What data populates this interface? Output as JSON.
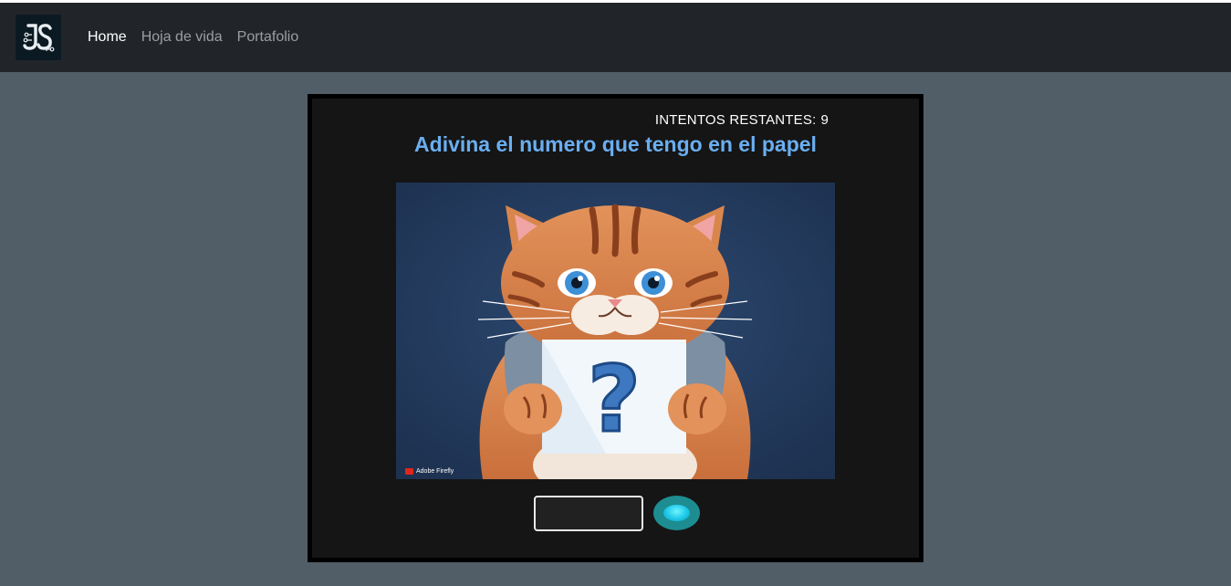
{
  "navbar": {
    "brand_icon": "js-logo-icon",
    "links": [
      {
        "label": "Home",
        "active": true
      },
      {
        "label": "Hoja de vida",
        "active": false
      },
      {
        "label": "Portafolio",
        "active": false
      }
    ]
  },
  "game": {
    "attempts_label": "INTENTOS RESTANTES:",
    "attempts_value": "9",
    "title": "Adivina el numero que tengo en el papel",
    "image_icon": "cat-holding-question-mark-sign",
    "watermark": "Adobe Firefly",
    "input": {
      "value": "",
      "placeholder": ""
    },
    "submit_icon": "cyan-oval-button-icon"
  },
  "colors": {
    "page_background": "#525e67",
    "navbar_background": "#212529",
    "card_background": "#151515",
    "title_color": "#6aaef0",
    "button_color": "#1d8d91"
  }
}
